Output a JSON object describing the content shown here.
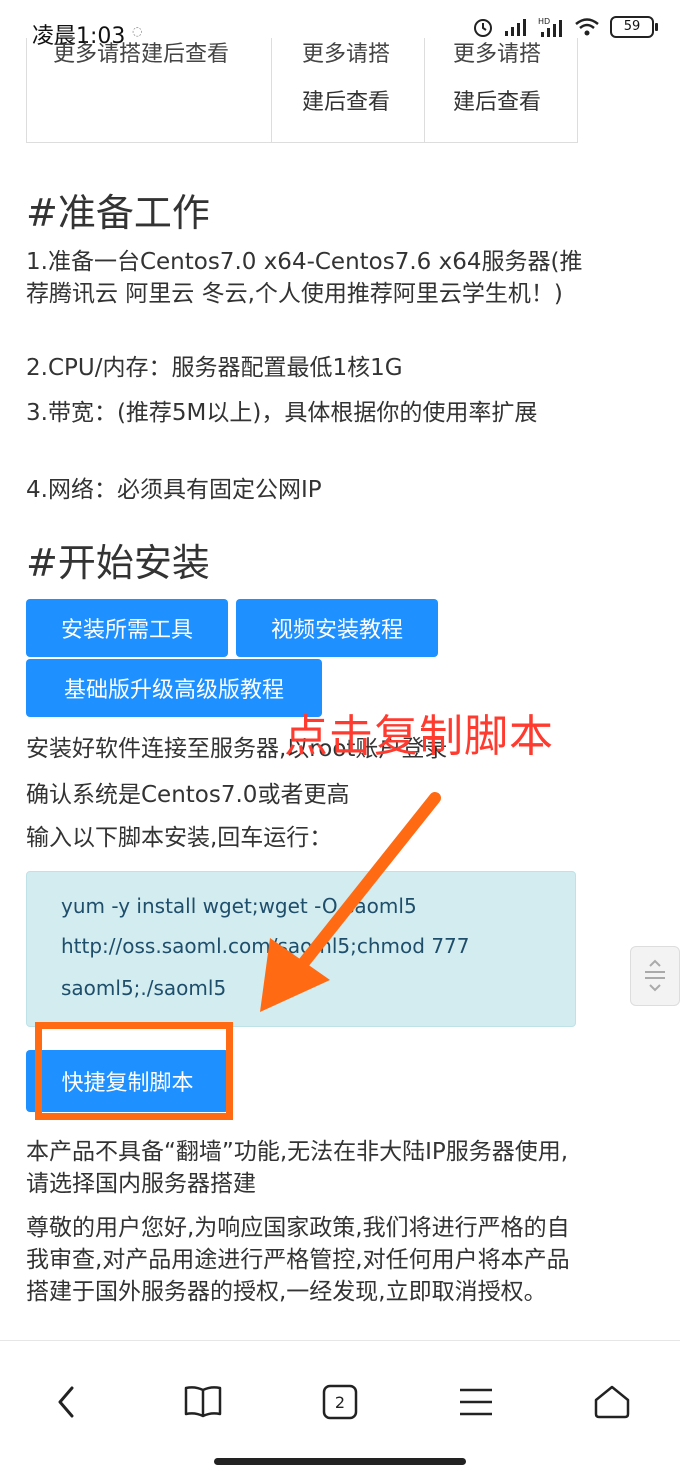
{
  "status_bar": {
    "time": "凌晨1:03",
    "battery": "59"
  },
  "table": {
    "col1_cut": "更多请搭建后查看",
    "col2_cut": "更多请搭",
    "col2_line": "建后查看",
    "col3_cut": "更多请搭",
    "col3_line": "建后查看"
  },
  "prep": {
    "heading": "#准备工作",
    "items": [
      "1.准备一台Centos7.0 x64-Centos7.6 x64服务器(推荐腾讯云 阿里云 冬云,个人使用推荐阿里云学生机！)",
      "2.CPU/内存：服务器配置最低1核1G",
      "3.带宽：(推荐5M以上)，具体根据你的使用率扩展",
      "4.网络：必须具有固定公网IP"
    ]
  },
  "install": {
    "heading": "#开始安装",
    "buttons": [
      "安装所需工具",
      "视频安装教程",
      "基础版升级高级版教程"
    ],
    "line1": "安装好软件连接至服务器,以root账户登录",
    "line2": "确认系统是Centos7.0或者更高",
    "line3": "输入以下脚本安装,回车运行：",
    "code_lines": [
      "yum -y install wget;wget -O saoml5",
      "http://oss.saoml.com/saoml5;chmod 777",
      "saoml5;./saoml5"
    ],
    "copy_button": "快捷复制脚本",
    "annotation": "点击复制脚本",
    "notice1": "本产品不具备“翻墙”功能,无法在非大陆IP服务器使用,请选择国内服务器搭建",
    "notice2": "尊敬的用户您好,为响应国家政策,我们将进行严格的自我审查,对产品用途进行严格管控,对任何用户将本产品搭建于国外服务器的授权,一经发现,立即取消授权。"
  },
  "bottom_nav": {
    "tabs_count": "2"
  },
  "colors": {
    "accent": "#1e90ff",
    "annotation": "#ff3b2f",
    "highlight": "#ff6a13",
    "code_bg": "#d2ecf0"
  }
}
